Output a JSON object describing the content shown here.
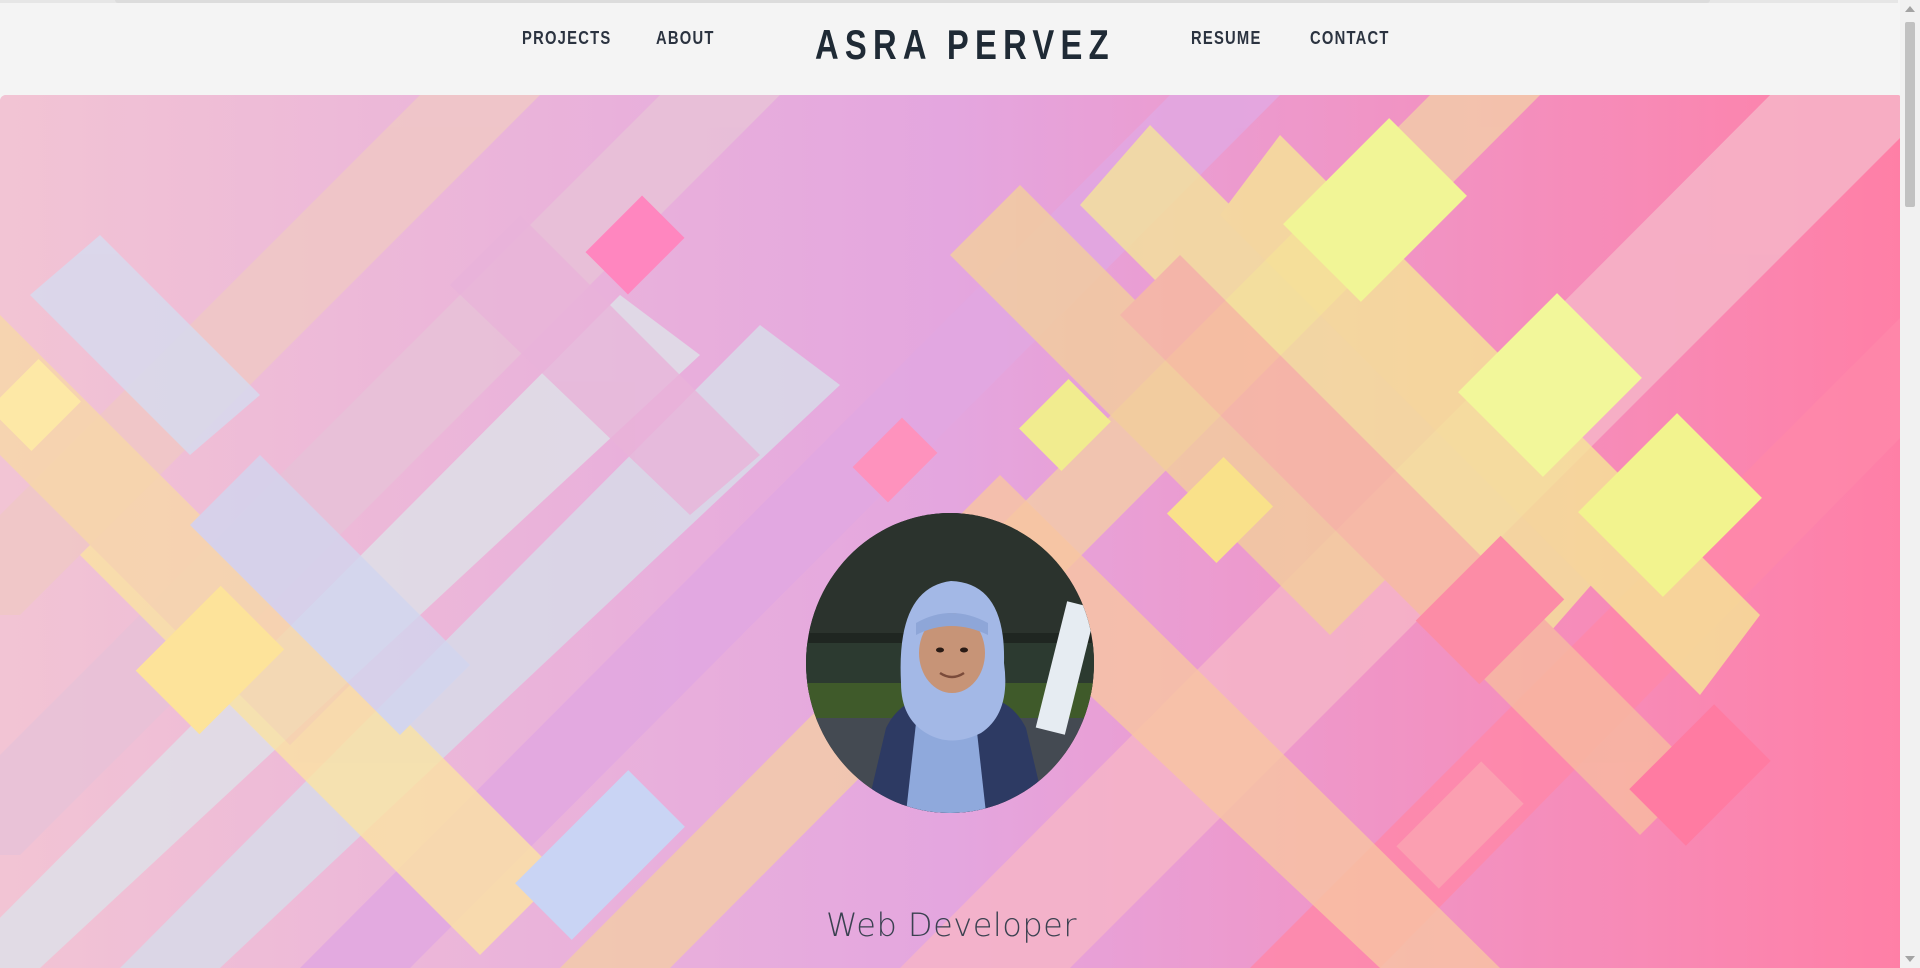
{
  "nav": {
    "links_left": [
      "PROJECTS",
      "ABOUT"
    ],
    "brand": "ASRA PERVEZ",
    "links_right": [
      "RESUME",
      "CONTACT"
    ]
  },
  "hero": {
    "role": "Web Developer",
    "avatar_alt": "Asra Pervez profile photo"
  },
  "colors": {
    "nav_text": "#2b3340",
    "brand_text": "#1f2a35",
    "nav_bg": "#f4f4f4",
    "role_text": "#3a4150"
  }
}
